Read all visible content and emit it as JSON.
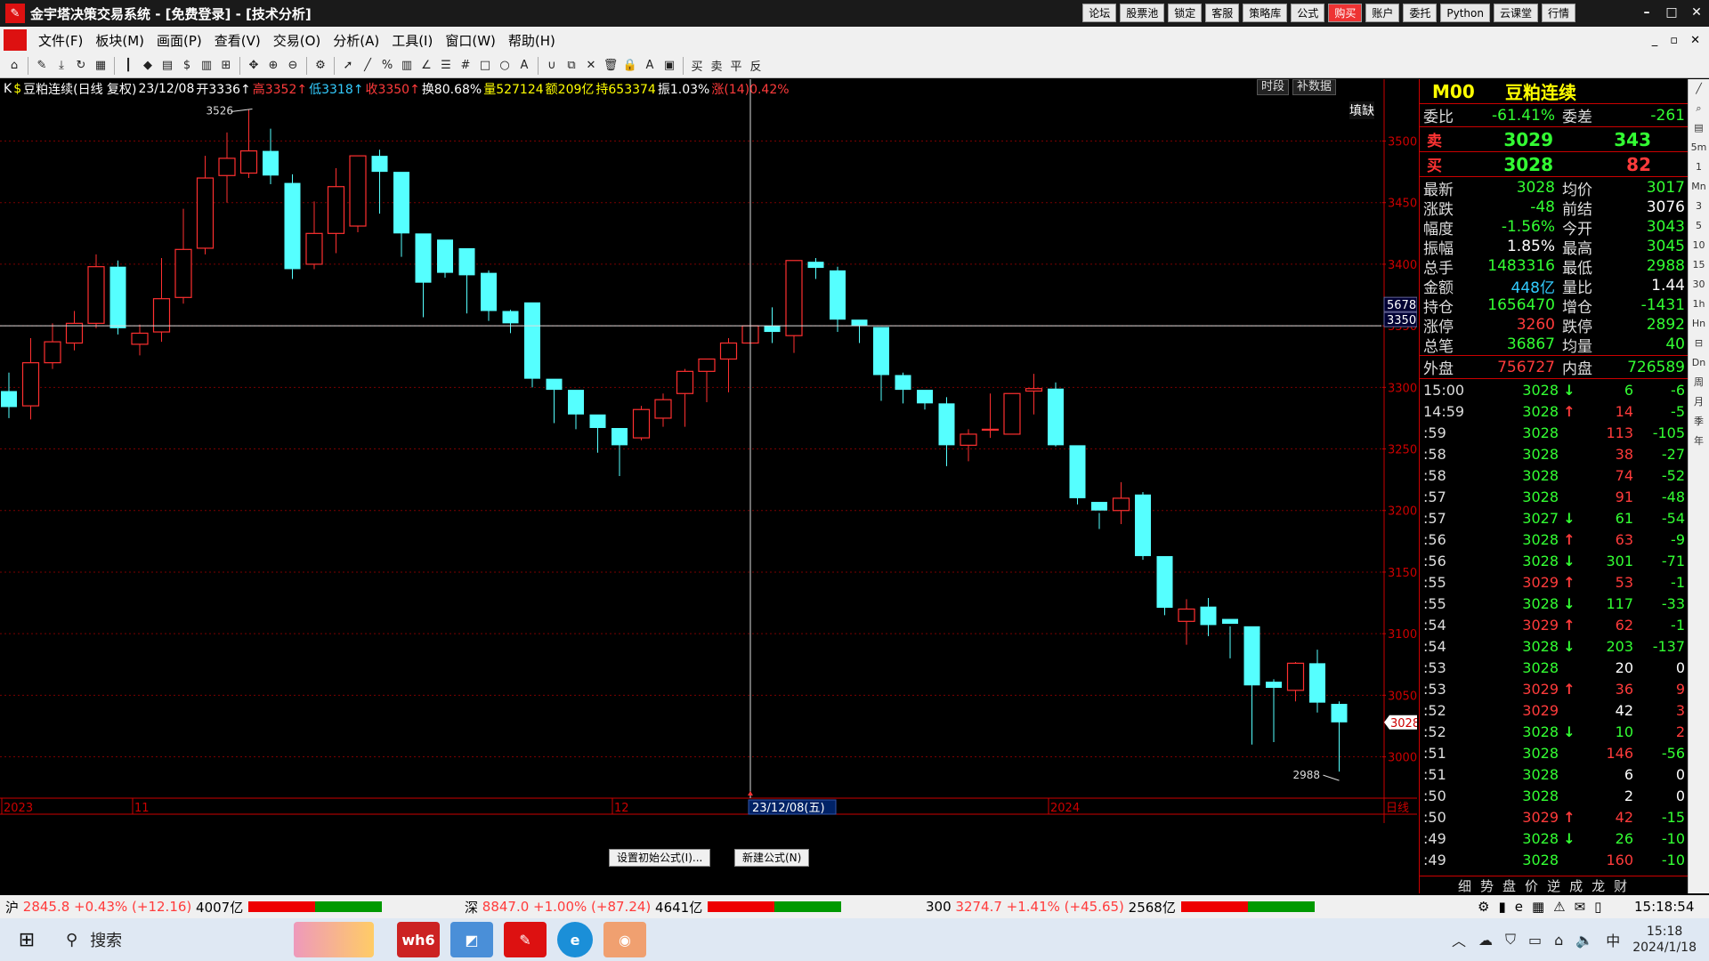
{
  "window": {
    "title": "金宇塔决策交易系统 - [免费登录] - [技术分析]",
    "buttons": [
      "论坛",
      "股票池",
      "锁定",
      "客服",
      "策略库",
      "公式",
      "购买",
      "账户",
      "委托",
      "Python",
      "云课堂",
      "行情"
    ]
  },
  "menu": [
    "文件(F)",
    "板块(M)",
    "画面(P)",
    "查看(V)",
    "交易(O)",
    "分析(A)",
    "工具(I)",
    "窗口(W)",
    "帮助(H)"
  ],
  "infobar": {
    "name": "豆粕连续(日线 复权)",
    "date": "23/12/08",
    "open": "开3336↑",
    "high": "高3352↑",
    "low": "低3318↑",
    "close": "收3350↑",
    "turnover": "换80.68%",
    "volume": "量527124",
    "amount": "额209亿",
    "oi": "持653374",
    "amplitude": "振1.03%",
    "change": "涨(14)0.42%",
    "btn_time": "时段",
    "btn_fill": "补数据",
    "fill_label": "填缺"
  },
  "chart_data": {
    "type": "candlestick",
    "title": "豆粕连续(日线 复权)",
    "ylim": [
      2978,
      3530
    ],
    "yticks": [
      3500,
      3450,
      3400,
      3350,
      3300,
      3250,
      3200,
      3150,
      3100,
      3050,
      3000
    ],
    "candles": [
      [
        3297,
        3312,
        3275,
        3284
      ],
      [
        3285,
        3340,
        3274,
        3320
      ],
      [
        3320,
        3352,
        3315,
        3337
      ],
      [
        3336,
        3362,
        3330,
        3352
      ],
      [
        3352,
        3408,
        3348,
        3398
      ],
      [
        3398,
        3403,
        3343,
        3348
      ],
      [
        3335,
        3351,
        3326,
        3344
      ],
      [
        3345,
        3405,
        3337,
        3372
      ],
      [
        3373,
        3445,
        3368,
        3412
      ],
      [
        3413,
        3488,
        3408,
        3470
      ],
      [
        3472,
        3507,
        3450,
        3486
      ],
      [
        3474,
        3526,
        3470,
        3492
      ],
      [
        3492,
        3510,
        3465,
        3472
      ],
      [
        3466,
        3473,
        3388,
        3396
      ],
      [
        3400,
        3451,
        3396,
        3425
      ],
      [
        3425,
        3478,
        3409,
        3463
      ],
      [
        3431,
        3487,
        3426,
        3488
      ],
      [
        3488,
        3493,
        3441,
        3475
      ],
      [
        3475,
        3450,
        3406,
        3425
      ],
      [
        3425,
        3410,
        3357,
        3385
      ],
      [
        3420,
        3405,
        3389,
        3393
      ],
      [
        3413,
        3393,
        3360,
        3391
      ],
      [
        3393,
        3395,
        3354,
        3362
      ],
      [
        3362,
        3363,
        3344,
        3352
      ],
      [
        3369,
        3356,
        3300,
        3307
      ],
      [
        3307,
        3303,
        3271,
        3298
      ],
      [
        3298,
        3283,
        3266,
        3278
      ],
      [
        3278,
        3268,
        3247,
        3267
      ],
      [
        3267,
        3259,
        3228,
        3253
      ],
      [
        3259,
        3285,
        3257,
        3282
      ],
      [
        3275,
        3295,
        3268,
        3290
      ],
      [
        3295,
        3315,
        3268,
        3313
      ],
      [
        3313,
        3323,
        3288,
        3323
      ],
      [
        3323,
        3340,
        3296,
        3336
      ],
      [
        3336,
        3352,
        3318,
        3350
      ],
      [
        3350,
        3365,
        3336,
        3345
      ],
      [
        3342,
        3400,
        3328,
        3403
      ],
      [
        3402,
        3405,
        3388,
        3397
      ],
      [
        3395,
        3398,
        3345,
        3355
      ],
      [
        3355,
        3353,
        3336,
        3350
      ],
      [
        3349,
        3344,
        3289,
        3310
      ],
      [
        3310,
        3312,
        3287,
        3298
      ],
      [
        3298,
        3292,
        3282,
        3287
      ],
      [
        3287,
        3292,
        3236,
        3253
      ],
      [
        3253,
        3266,
        3240,
        3262
      ],
      [
        3266,
        3295,
        3259,
        3266
      ],
      [
        3262,
        3292,
        3262,
        3295
      ],
      [
        3297,
        3311,
        3278,
        3299
      ],
      [
        3299,
        3304,
        3252,
        3253
      ],
      [
        3253,
        3250,
        3205,
        3210
      ],
      [
        3207,
        3198,
        3185,
        3200
      ],
      [
        3200,
        3223,
        3189,
        3210
      ],
      [
        3213,
        3215,
        3160,
        3163
      ],
      [
        3163,
        3150,
        3115,
        3121
      ],
      [
        3110,
        3128,
        3091,
        3120
      ],
      [
        3122,
        3129,
        3098,
        3107
      ],
      [
        3112,
        3106,
        3080,
        3108
      ],
      [
        3106,
        3103,
        3010,
        3058
      ],
      [
        3061,
        3063,
        3012,
        3056
      ],
      [
        3054,
        3077,
        3045,
        3076
      ],
      [
        3076,
        3087,
        3036,
        3044
      ],
      [
        3043,
        3045,
        2988,
        3028
      ]
    ],
    "hi_label": "3526",
    "lo_label": "2988",
    "price_tag": "3028",
    "cross_tags": [
      "5678",
      "3350"
    ],
    "xlabels": [
      {
        "i": 0,
        "t": "2023"
      },
      {
        "i": 6,
        "t": "11"
      },
      {
        "i": 28,
        "t": "12"
      },
      {
        "i": 48,
        "t": "2024"
      }
    ],
    "cursor_label": "23/12/08(五)",
    "period": "日线",
    "cursor_index": 34
  },
  "buttons": {
    "init_formula": "设置初始公式(I)...",
    "new_formula": "新建公式(N)"
  },
  "panel": {
    "code": "M00",
    "name": "豆粕连续",
    "weibi": "委比",
    "weibi_v": "-61.41%",
    "weicha": "委差",
    "weicha_v": "-261",
    "sell": "卖",
    "sell_p": "3029",
    "sell_v": "343",
    "buy": "买",
    "buy_p": "3028",
    "buy_v": "82",
    "stats": [
      [
        "最新",
        "3028",
        "均价",
        "3017"
      ],
      [
        "涨跌",
        "-48",
        "前结",
        "3076"
      ],
      [
        "幅度",
        "-1.56%",
        "今开",
        "3043"
      ],
      [
        "振幅",
        "1.85%",
        "最高",
        "3045"
      ],
      [
        "总手",
        "1483316",
        "最低",
        "2988"
      ],
      [
        "金额",
        "448亿",
        "量比",
        "1.44"
      ],
      [
        "持仓",
        "1656470",
        "增仓",
        "-1431"
      ],
      [
        "涨停",
        "3260",
        "跌停",
        "2892"
      ],
      [
        "总笔",
        "36867",
        "均量",
        "40"
      ]
    ],
    "outer": "外盘",
    "outer_v": "756727",
    "inner": "内盘",
    "inner_v": "726589",
    "ticks": [
      [
        "15:00",
        "3028",
        "↓",
        "6",
        "-6"
      ],
      [
        "14:59",
        "3028",
        "↑",
        "14",
        "-5"
      ],
      [
        ":59",
        "3028",
        "",
        "113",
        "-105"
      ],
      [
        ":58",
        "3028",
        "",
        "38",
        "-27"
      ],
      [
        ":58",
        "3028",
        "",
        "74",
        "-52"
      ],
      [
        ":57",
        "3028",
        "",
        "91",
        "-48"
      ],
      [
        ":57",
        "3027",
        "↓",
        "61",
        "-54"
      ],
      [
        ":56",
        "3028",
        "↑",
        "63",
        "-9"
      ],
      [
        ":56",
        "3028",
        "↓",
        "301",
        "-71"
      ],
      [
        ":55",
        "3029",
        "↑",
        "53",
        "-1"
      ],
      [
        ":55",
        "3028",
        "↓",
        "117",
        "-33"
      ],
      [
        ":54",
        "3029",
        "↑",
        "62",
        "-1"
      ],
      [
        ":54",
        "3028",
        "↓",
        "203",
        "-137"
      ],
      [
        ":53",
        "3028",
        "",
        "20",
        "0"
      ],
      [
        ":53",
        "3029",
        "↑",
        "36",
        "9"
      ],
      [
        ":52",
        "3029",
        "",
        "42",
        "3"
      ],
      [
        ":52",
        "3028",
        "↓",
        "10",
        "2"
      ],
      [
        ":51",
        "3028",
        "",
        "146",
        "-56"
      ],
      [
        ":51",
        "3028",
        "",
        "6",
        "0"
      ],
      [
        ":50",
        "3028",
        "",
        "2",
        "0"
      ],
      [
        ":50",
        "3029",
        "↑",
        "42",
        "-15"
      ],
      [
        ":49",
        "3028",
        "↓",
        "26",
        "-10"
      ],
      [
        ":49",
        "3028",
        "",
        "160",
        "-10"
      ]
    ],
    "tabs": [
      "细",
      "势",
      "盘",
      "价",
      "逆",
      "成",
      "龙",
      "财"
    ]
  },
  "status": {
    "sh": "沪",
    "sh_v": "2845.8 +0.43% (+12.16)",
    "sh_amt": "4007亿",
    "sz": "深",
    "sz_v": "8847.0 +1.00% (+87.24)",
    "sz_amt": "4641亿",
    "hs": "300",
    "hs_v": "3274.7 +1.41% (+45.65)",
    "hs_amt": "2568亿",
    "time": "15:18:54"
  },
  "taskbar": {
    "search": "搜索",
    "time": "15:18",
    "date": "2024/1/18",
    "ime": "中"
  }
}
